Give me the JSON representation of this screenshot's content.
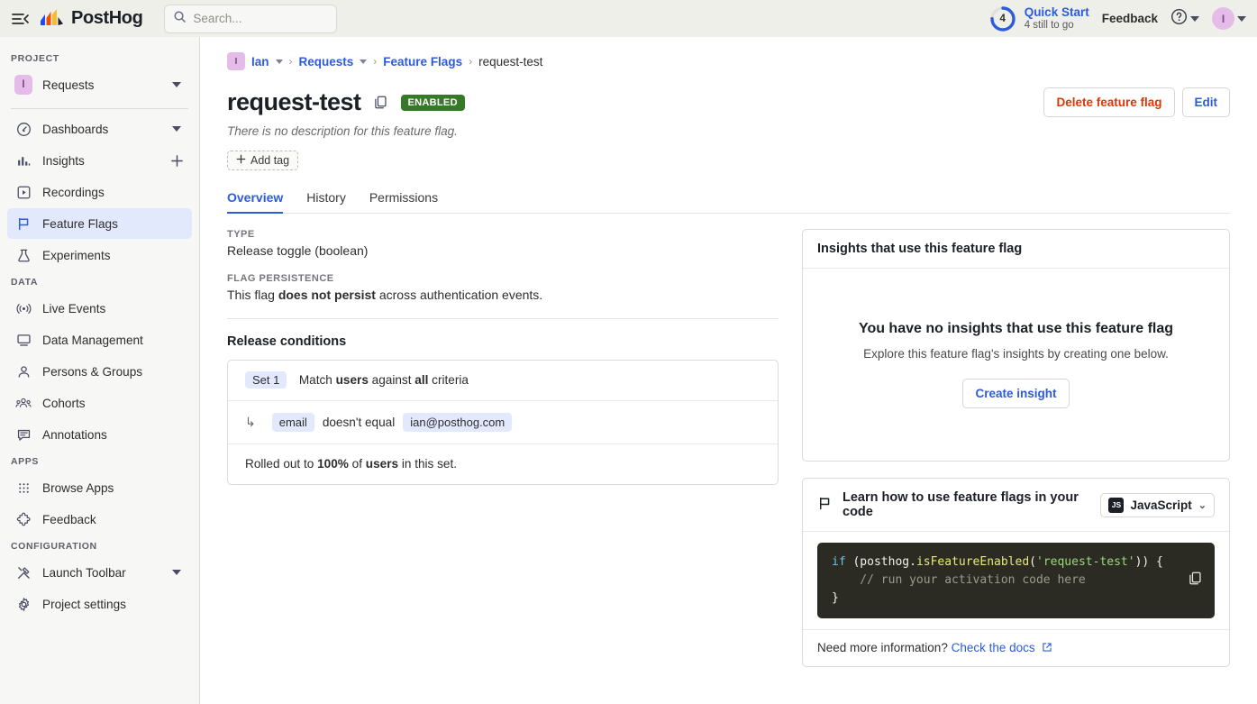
{
  "topbar": {
    "collapse_icon": "collapse-sidebar-icon",
    "brand": "PostHog",
    "search_placeholder": "Search...",
    "search_value": "",
    "search_icon": "search-icon",
    "quick_start": {
      "title": "Quick Start",
      "subtitle": "4 still to go",
      "count": "4",
      "progress_percent": 75
    },
    "feedback": "Feedback",
    "help_icon": "question-circle-icon",
    "avatar_initial": "I"
  },
  "sidebar": {
    "sections": [
      {
        "label": "PROJECT",
        "items": [
          {
            "label": "Requests",
            "icon": "project-badge-icon",
            "badge": "I",
            "right": "chevron-down-icon",
            "active": false
          }
        ]
      },
      {
        "label": "",
        "items": [
          {
            "label": "Dashboards",
            "icon": "dashboard-icon",
            "right": "chevron-down-icon",
            "active": false
          },
          {
            "label": "Insights",
            "icon": "insights-bar-icon",
            "right": "plus-icon",
            "active": false
          },
          {
            "label": "Recordings",
            "icon": "play-square-icon",
            "right": "",
            "active": false
          },
          {
            "label": "Feature Flags",
            "icon": "flag-icon",
            "right": "",
            "active": true
          },
          {
            "label": "Experiments",
            "icon": "flask-icon",
            "right": "",
            "active": false
          }
        ]
      },
      {
        "label": "DATA",
        "items": [
          {
            "label": "Live Events",
            "icon": "broadcast-icon",
            "right": "",
            "active": false
          },
          {
            "label": "Data Management",
            "icon": "monitor-icon",
            "right": "",
            "active": false
          },
          {
            "label": "Persons & Groups",
            "icon": "person-icon",
            "right": "",
            "active": false
          },
          {
            "label": "Cohorts",
            "icon": "people-group-icon",
            "right": "",
            "active": false
          },
          {
            "label": "Annotations",
            "icon": "comment-lines-icon",
            "right": "",
            "active": false
          }
        ]
      },
      {
        "label": "APPS",
        "items": [
          {
            "label": "Browse Apps",
            "icon": "grid-dots-icon",
            "right": "",
            "active": false
          },
          {
            "label": "Feedback",
            "icon": "puzzle-icon",
            "right": "",
            "active": false
          }
        ]
      },
      {
        "label": "CONFIGURATION",
        "items": [
          {
            "label": "Launch Toolbar",
            "icon": "tools-icon",
            "right": "chevron-down-icon",
            "active": false
          },
          {
            "label": "Project settings",
            "icon": "gear-icon",
            "right": "",
            "active": false
          }
        ]
      }
    ]
  },
  "breadcrumb": {
    "org_badge": "I",
    "org": "Ian",
    "project": "Requests",
    "section": "Feature Flags",
    "current": "request-test",
    "separator": "›"
  },
  "page": {
    "title": "request-test",
    "status_badge": "ENABLED",
    "description": "There is no description for this feature flag.",
    "copy_icon": "copy-icon",
    "add_tag": "Add tag",
    "delete_button": "Delete feature flag",
    "edit_button": "Edit"
  },
  "tabs": [
    {
      "label": "Overview",
      "active": true
    },
    {
      "label": "History",
      "active": false
    },
    {
      "label": "Permissions",
      "active": false
    }
  ],
  "overview": {
    "type_label": "TYPE",
    "type_value": "Release toggle (boolean)",
    "persistence_label": "FLAG PERSISTENCE",
    "persistence_prefix": "This flag ",
    "persistence_bold": "does not persist",
    "persistence_suffix": " across authentication events.",
    "release_conditions_heading": "Release conditions",
    "condition_set": {
      "set_chip": "Set 1",
      "match_prefix": "Match ",
      "match_entity": "users",
      "match_middle": " against ",
      "match_criteria": "all",
      "match_suffix": " criteria",
      "arrow": "↳",
      "property": "email",
      "operator": "doesn't equal",
      "value": "ian@posthog.com",
      "rollout_prefix": "Rolled out to ",
      "rollout_percent": "100%",
      "rollout_middle": " of ",
      "rollout_entity": "users",
      "rollout_suffix": " in this set."
    }
  },
  "insights_panel": {
    "header": "Insights that use this feature flag",
    "empty_title": "You have no insights that use this feature flag",
    "empty_subtitle": "Explore this feature flag's insights by creating one below.",
    "create_button": "Create insight"
  },
  "code_panel": {
    "flag_icon": "flag-outline-icon",
    "header": "Learn how to use feature flags in your code",
    "language": "JavaScript",
    "language_badge": "JS",
    "chevron_icon": "chevron-down-icon",
    "copy_icon": "copy-icon",
    "code": {
      "kw_if": "if",
      "open": " (posthog.",
      "fn": "isFeatureEnabled",
      "paren": "(",
      "str": "'request-test'",
      "close": ")) {",
      "comment": "    // run your activation code here",
      "end": "}"
    },
    "footer_prefix": "Need more information? ",
    "footer_link": "Check the docs",
    "external_icon": "external-link-icon"
  },
  "colors": {
    "accent_blue": "#2c5cdb",
    "danger_red": "#db3707",
    "enabled_green": "#357a26",
    "badge_purple": "#e5bbe8",
    "sidebar_bg": "#f7f7f5",
    "topbar_bg": "#eeefe9",
    "code_bg": "#2b2b23"
  }
}
